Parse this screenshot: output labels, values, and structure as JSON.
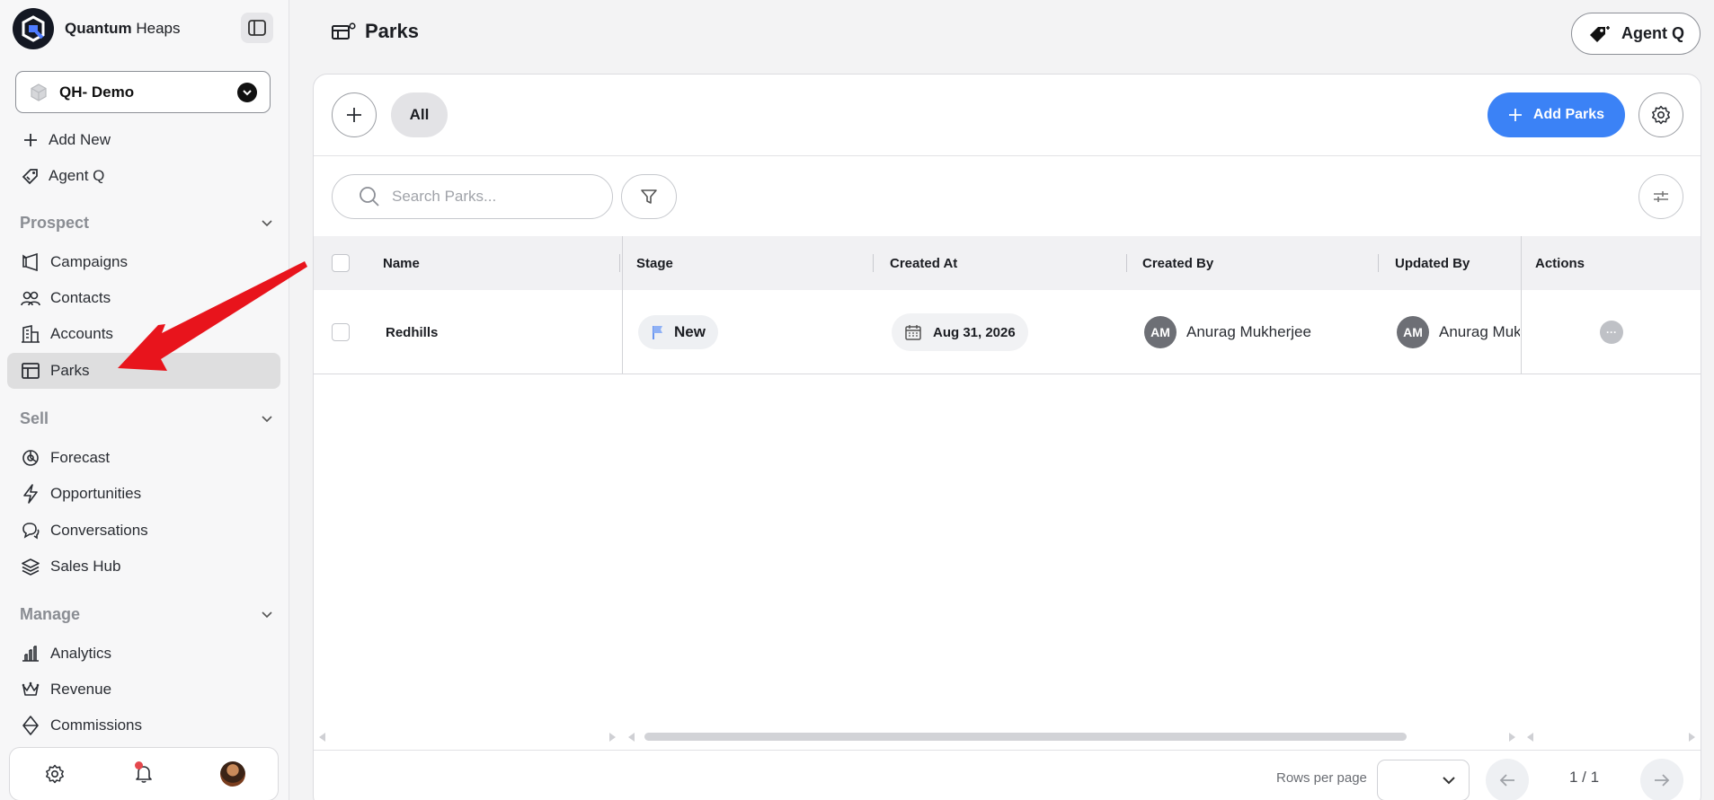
{
  "brand": {
    "name_bold": "Quantum",
    "name_rest": " Heaps"
  },
  "workspace": {
    "label": "QH- Demo"
  },
  "sidebar": {
    "top_items": [
      {
        "label": "Add New",
        "icon": "plus-icon"
      },
      {
        "label": "Agent Q",
        "icon": "agent-q-icon"
      }
    ],
    "sections": [
      {
        "title": "Prospect",
        "items": [
          {
            "label": "Campaigns",
            "icon": "megaphone-icon"
          },
          {
            "label": "Contacts",
            "icon": "users-icon"
          },
          {
            "label": "Accounts",
            "icon": "building-icon"
          },
          {
            "label": "Parks",
            "icon": "layout-icon",
            "active": true
          }
        ]
      },
      {
        "title": "Sell",
        "items": [
          {
            "label": "Forecast",
            "icon": "forecast-icon"
          },
          {
            "label": "Opportunities",
            "icon": "lightning-icon"
          },
          {
            "label": "Conversations",
            "icon": "chat-icon"
          },
          {
            "label": "Sales Hub",
            "icon": "layers-icon"
          }
        ]
      },
      {
        "title": "Manage",
        "items": [
          {
            "label": "Analytics",
            "icon": "bar-chart-icon"
          },
          {
            "label": "Revenue",
            "icon": "crown-icon"
          },
          {
            "label": "Commissions",
            "icon": "diamond-icon"
          }
        ]
      }
    ]
  },
  "header": {
    "title": "Parks",
    "agent_button": "Agent Q"
  },
  "toolbar": {
    "view_all": "All",
    "add_button": "Add Parks"
  },
  "search": {
    "placeholder": "Search Parks..."
  },
  "table": {
    "columns": [
      "Name",
      "Stage",
      "Created At",
      "Created By",
      "Updated By",
      "Actions"
    ],
    "rows": [
      {
        "name": "Redhills",
        "stage": "New",
        "created_at": "Aug 31, 2026",
        "created_by": {
          "initials": "AM",
          "name": "Anurag Mukherjee"
        },
        "updated_by": {
          "initials": "AM",
          "name": "Anurag Mukherjee"
        },
        "actions": "···"
      }
    ]
  },
  "pagination": {
    "rows_label": "Rows per page",
    "rows_value": "",
    "page_info": "1 / 1"
  },
  "colors": {
    "accent": "#3b82f6",
    "active_nav_bg": "#dededf",
    "annotation_arrow": "#e8141c",
    "notification": "#e5484d"
  }
}
